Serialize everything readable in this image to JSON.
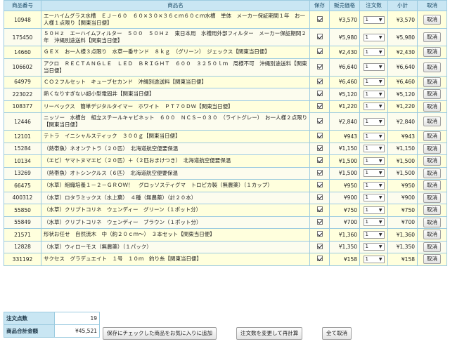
{
  "header": {
    "code": "商品番号",
    "name": "商品名",
    "keep": "保存",
    "price": "販売価格",
    "qty": "注文数",
    "subtotal": "小計",
    "cancel": "取消"
  },
  "cancel_label": "取消",
  "rows": [
    {
      "code": "10948",
      "name": "エーハイムグラス水槽　ＥＪ－６０　６０×３０×３６ｃｍ６０ｃｍ水槽　単体　メーカー保証期間１年　お一人様１点限り【関東当日便】",
      "price": "¥3,570",
      "qty": "1",
      "subtotal": "¥3,570",
      "tall": true
    },
    {
      "code": "175450",
      "name": "５０Ｈｚ　エーハイムフィルター　５００　５０Ｈｚ　東日本用　水槽用外部フィルター　メーカー保証期間２年　沖縄別途送料【関東当日便】",
      "price": "¥5,980",
      "qty": "1",
      "subtotal": "¥5,980",
      "tall": true
    },
    {
      "code": "14660",
      "name": "ＧＥＸ　お一人様３点限り　水草一番サンド　８ｋｇ　（グリーン）　ジェックス【関東当日便】",
      "price": "¥2,430",
      "qty": "1",
      "subtotal": "¥2,430",
      "tall": false
    },
    {
      "code": "106602",
      "name": "アクロ　ＲＥＣＴＡＮＧＬＥ　ＬＥＤ　ＢＲＩＧＨＴ　６００　３２５０ｌｍ　周様不可　沖縄別途送料【関東当日便】",
      "price": "¥6,640",
      "qty": "1",
      "subtotal": "¥6,640",
      "tall": true
    },
    {
      "code": "64979",
      "name": "ＣＯ２フルセット　キューブセカンド　沖縄別途送料【関東当日便】",
      "price": "¥6,460",
      "qty": "1",
      "subtotal": "¥6,460",
      "tall": false
    },
    {
      "code": "223022",
      "name": "熱くなりすぎない超小型電固井【関東当日便】",
      "price": "¥5,120",
      "qty": "1",
      "subtotal": "¥5,120",
      "tall": false
    },
    {
      "code": "108377",
      "name": "リーベックス　簡単デジタルタイマー　ホワイト　ＰＴ７０ＤＷ【関東当日便】",
      "price": "¥1,220",
      "qty": "1",
      "subtotal": "¥1,220",
      "tall": false
    },
    {
      "code": "12446",
      "name": "ニッソー　水槽台　組立スチールキャビネット　６００　ＮＣＳ－０３０　（ライトグレー）　お一人様２点限り【関東当日便】",
      "price": "¥2,840",
      "qty": "1",
      "subtotal": "¥2,840",
      "tall": true
    },
    {
      "code": "12101",
      "name": "テトラ　イニシャルスティック　３００ｇ【関東当日便】",
      "price": "¥943",
      "qty": "1",
      "subtotal": "¥943",
      "tall": false
    },
    {
      "code": "15284",
      "name": "（熱帯魚）ネオンテトラ（２０匹）　北海道航空便要保温",
      "price": "¥1,150",
      "qty": "1",
      "subtotal": "¥1,150",
      "tall": false
    },
    {
      "code": "10134",
      "name": "（エビ）ヤマトヌマエビ（２０匹）＋（２匹おまけつき）　北海道航空便要保温",
      "price": "¥1,500",
      "qty": "1",
      "subtotal": "¥1,500",
      "tall": false
    },
    {
      "code": "13269",
      "name": "（熱帯魚）オトシンクルス（６匹）　北海道航空便要保温",
      "price": "¥1,500",
      "qty": "1",
      "subtotal": "¥1,500",
      "tall": false
    },
    {
      "code": "66475",
      "name": "（水草）組織培養１－２－ＧＲＯＷ！　グロッソスティグマ　トロピカ製（無農薬）（１カップ）",
      "price": "¥950",
      "qty": "1",
      "subtotal": "¥950",
      "tall": false
    },
    {
      "code": "400312",
      "name": "（水草）ロタラミックス（水上葉）　４種（無農薬）（計２０本）",
      "price": "¥900",
      "qty": "1",
      "subtotal": "¥900",
      "tall": false
    },
    {
      "code": "55850",
      "name": "（水草）クリプトコリネ　ウェンディー　グリーン（１ポット分）",
      "price": "¥750",
      "qty": "1",
      "subtotal": "¥750",
      "tall": false
    },
    {
      "code": "55849",
      "name": "（水草）クリプトコリネ　ウェンディー　ブラウン（１ポット分）",
      "price": "¥700",
      "qty": "1",
      "subtotal": "¥700",
      "tall": false
    },
    {
      "code": "21571",
      "name": "形状お任せ　自然流木　中（約２０ｃｍ～）　３本セット【関東当日便】",
      "price": "¥1,360",
      "qty": "1",
      "subtotal": "¥1,360",
      "tall": false
    },
    {
      "code": "12828",
      "name": "（水草）ウィローモス（無農薬）（１パック）",
      "price": "¥1,350",
      "qty": "1",
      "subtotal": "¥1,350",
      "tall": false
    },
    {
      "code": "331192",
      "name": "サクセス　グラデュエイト　１号　１０ｍ　釣り糸【関東当日便】",
      "price": "¥158",
      "qty": "1",
      "subtotal": "¥158",
      "tall": false
    }
  ],
  "summary": {
    "count_label": "注文点数",
    "count_value": "19",
    "total_label": "商品合計金額",
    "total_value": "¥45,521"
  },
  "actions": {
    "favorite": "保存にチェックした商品をお気に入りに追加",
    "recalc": "注文数を変更して再計算",
    "cancel_all": "全て取消"
  }
}
